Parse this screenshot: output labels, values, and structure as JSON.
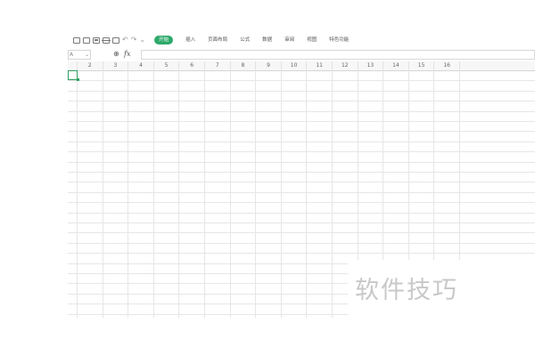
{
  "toolbar": {
    "undo_glyph": "↶",
    "redo_glyph": "↷",
    "more_glyph": "⌄",
    "tabs": [
      {
        "label": "开始",
        "active": true
      },
      {
        "label": "插入",
        "active": false
      },
      {
        "label": "页面布局",
        "active": false
      },
      {
        "label": "公式",
        "active": false
      },
      {
        "label": "数据",
        "active": false
      },
      {
        "label": "审阅",
        "active": false
      },
      {
        "label": "视图",
        "active": false
      },
      {
        "label": "特色功能",
        "active": false
      }
    ],
    "active_color": "#2eaa6a"
  },
  "formula_bar": {
    "name_box": "A",
    "name_box_arrow": "⌄",
    "zoom_glyph": "⊕",
    "fx_label": "fx",
    "formula_value": ""
  },
  "grid": {
    "column_labels": [
      "",
      "2",
      "3",
      "4",
      "5",
      "6",
      "7",
      "8",
      "9",
      "10",
      "11",
      "12",
      "13",
      "14",
      "15",
      "16"
    ],
    "active_color": "#2e9f63"
  },
  "watermark": {
    "text": "软件技巧"
  }
}
